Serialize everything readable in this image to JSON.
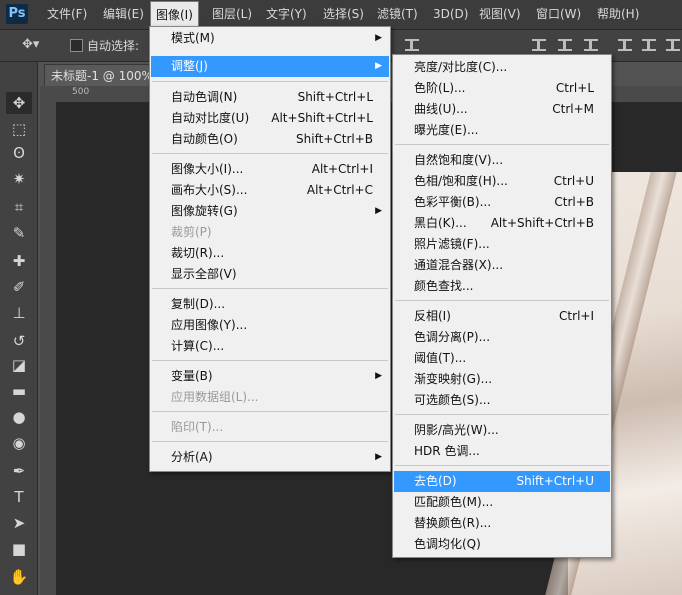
{
  "app": {
    "logo": "Ps"
  },
  "menubar": [
    {
      "label": "文件(F)"
    },
    {
      "label": "编辑(E)"
    },
    {
      "label": "图像(I)"
    },
    {
      "label": "图层(L)"
    },
    {
      "label": "文字(Y)"
    },
    {
      "label": "选择(S)"
    },
    {
      "label": "滤镜(T)"
    },
    {
      "label": "3D(D)"
    },
    {
      "label": "视图(V)"
    },
    {
      "label": "窗口(W)"
    },
    {
      "label": "帮助(H)"
    }
  ],
  "options": {
    "auto_select": "自动选择:"
  },
  "document": {
    "tab_title": "未标题-1 @ 100%",
    "ruler_mark": "500"
  },
  "image_menu": [
    {
      "label": "模式(M)",
      "shortcut": "",
      "submenu": true,
      "disabled": false,
      "highlight": false
    },
    {
      "label": "调整(J)",
      "shortcut": "",
      "submenu": true,
      "disabled": false,
      "highlight": true
    },
    {
      "label": "自动色调(N)",
      "shortcut": "Shift+Ctrl+L",
      "submenu": false,
      "disabled": false,
      "highlight": false
    },
    {
      "label": "自动对比度(U)",
      "shortcut": "Alt+Shift+Ctrl+L",
      "submenu": false,
      "disabled": false,
      "highlight": false
    },
    {
      "label": "自动颜色(O)",
      "shortcut": "Shift+Ctrl+B",
      "submenu": false,
      "disabled": false,
      "highlight": false
    },
    {
      "label": "图像大小(I)...",
      "shortcut": "Alt+Ctrl+I",
      "submenu": false,
      "disabled": false,
      "highlight": false
    },
    {
      "label": "画布大小(S)...",
      "shortcut": "Alt+Ctrl+C",
      "submenu": false,
      "disabled": false,
      "highlight": false
    },
    {
      "label": "图像旋转(G)",
      "shortcut": "",
      "submenu": true,
      "disabled": false,
      "highlight": false
    },
    {
      "label": "裁剪(P)",
      "shortcut": "",
      "submenu": false,
      "disabled": true,
      "highlight": false
    },
    {
      "label": "裁切(R)...",
      "shortcut": "",
      "submenu": false,
      "disabled": false,
      "highlight": false
    },
    {
      "label": "显示全部(V)",
      "shortcut": "",
      "submenu": false,
      "disabled": false,
      "highlight": false
    },
    {
      "label": "复制(D)...",
      "shortcut": "",
      "submenu": false,
      "disabled": false,
      "highlight": false
    },
    {
      "label": "应用图像(Y)...",
      "shortcut": "",
      "submenu": false,
      "disabled": false,
      "highlight": false
    },
    {
      "label": "计算(C)...",
      "shortcut": "",
      "submenu": false,
      "disabled": false,
      "highlight": false
    },
    {
      "label": "变量(B)",
      "shortcut": "",
      "submenu": true,
      "disabled": false,
      "highlight": false
    },
    {
      "label": "应用数据组(L)...",
      "shortcut": "",
      "submenu": false,
      "disabled": true,
      "highlight": false
    },
    {
      "label": "陷印(T)...",
      "shortcut": "",
      "submenu": false,
      "disabled": true,
      "highlight": false
    },
    {
      "label": "分析(A)",
      "shortcut": "",
      "submenu": true,
      "disabled": false,
      "highlight": false
    }
  ],
  "adjust_menu": [
    {
      "label": "亮度/对比度(C)...",
      "shortcut": "",
      "highlight": false
    },
    {
      "label": "色阶(L)...",
      "shortcut": "Ctrl+L",
      "highlight": false
    },
    {
      "label": "曲线(U)...",
      "shortcut": "Ctrl+M",
      "highlight": false
    },
    {
      "label": "曝光度(E)...",
      "shortcut": "",
      "highlight": false
    },
    {
      "label": "自然饱和度(V)...",
      "shortcut": "",
      "highlight": false
    },
    {
      "label": "色相/饱和度(H)...",
      "shortcut": "Ctrl+U",
      "highlight": false
    },
    {
      "label": "色彩平衡(B)...",
      "shortcut": "Ctrl+B",
      "highlight": false
    },
    {
      "label": "黑白(K)...",
      "shortcut": "Alt+Shift+Ctrl+B",
      "highlight": false
    },
    {
      "label": "照片滤镜(F)...",
      "shortcut": "",
      "highlight": false
    },
    {
      "label": "通道混合器(X)...",
      "shortcut": "",
      "highlight": false
    },
    {
      "label": "颜色查找...",
      "shortcut": "",
      "highlight": false
    },
    {
      "label": "反相(I)",
      "shortcut": "Ctrl+I",
      "highlight": false
    },
    {
      "label": "色调分离(P)...",
      "shortcut": "",
      "highlight": false
    },
    {
      "label": "阈值(T)...",
      "shortcut": "",
      "highlight": false
    },
    {
      "label": "渐变映射(G)...",
      "shortcut": "",
      "highlight": false
    },
    {
      "label": "可选颜色(S)...",
      "shortcut": "",
      "highlight": false
    },
    {
      "label": "阴影/高光(W)...",
      "shortcut": "",
      "highlight": false
    },
    {
      "label": "HDR 色调...",
      "shortcut": "",
      "highlight": false
    },
    {
      "label": "去色(D)",
      "shortcut": "Shift+Ctrl+U",
      "highlight": true
    },
    {
      "label": "匹配颜色(M)...",
      "shortcut": "",
      "highlight": false
    },
    {
      "label": "替换颜色(R)...",
      "shortcut": "",
      "highlight": false
    },
    {
      "label": "色调均化(Q)",
      "shortcut": "",
      "highlight": false
    }
  ],
  "tools": [
    {
      "icon": "move-tool-icon",
      "glyph": "✥"
    },
    {
      "icon": "marquee-tool-icon",
      "glyph": "⬚"
    },
    {
      "icon": "lasso-tool-icon",
      "glyph": "ʘ"
    },
    {
      "icon": "magic-wand-tool-icon",
      "glyph": "✷"
    },
    {
      "icon": "crop-tool-icon",
      "glyph": "⌗"
    },
    {
      "icon": "eyedropper-tool-icon",
      "glyph": "✎"
    },
    {
      "icon": "healing-brush-tool-icon",
      "glyph": "✚"
    },
    {
      "icon": "brush-tool-icon",
      "glyph": "✐"
    },
    {
      "icon": "clone-stamp-tool-icon",
      "glyph": "⊥"
    },
    {
      "icon": "history-brush-tool-icon",
      "glyph": "↺"
    },
    {
      "icon": "eraser-tool-icon",
      "glyph": "◪"
    },
    {
      "icon": "gradient-tool-icon",
      "glyph": "▬"
    },
    {
      "icon": "blur-tool-icon",
      "glyph": "●"
    },
    {
      "icon": "dodge-tool-icon",
      "glyph": "◉"
    },
    {
      "icon": "pen-tool-icon",
      "glyph": "✒"
    },
    {
      "icon": "type-tool-icon",
      "glyph": "T"
    },
    {
      "icon": "path-selection-tool-icon",
      "glyph": "➤"
    },
    {
      "icon": "shape-tool-icon",
      "glyph": "■"
    },
    {
      "icon": "hand-tool-icon",
      "glyph": "✋"
    }
  ],
  "colors": {
    "highlight": "#3399ff",
    "menu_bg": "#f0f0f0",
    "ui_dark": "#424242"
  }
}
